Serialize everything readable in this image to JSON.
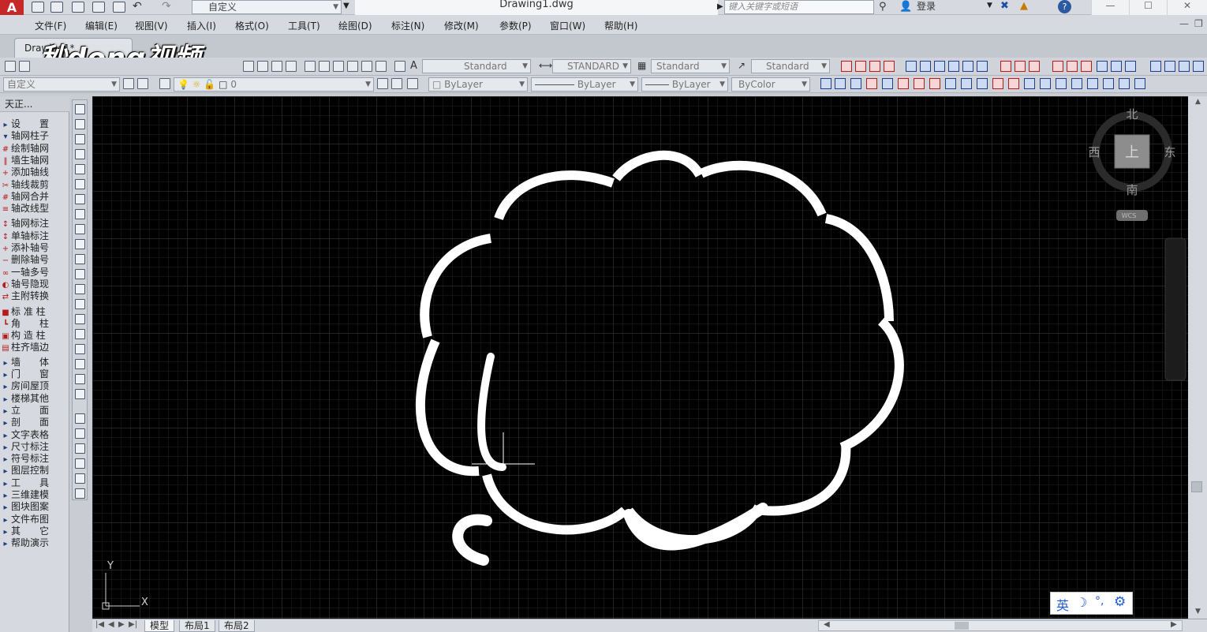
{
  "window": {
    "app_logo": "A",
    "workspace": "自定义",
    "document_title": "Drawing1.dwg",
    "search_placeholder": "键入关键字或短语",
    "login_label": "登录",
    "help_label": "?"
  },
  "menu": [
    "文件(F)",
    "编辑(E)",
    "视图(V)",
    "插入(I)",
    "格式(O)",
    "工具(T)",
    "绘图(D)",
    "标注(N)",
    "修改(M)",
    "参数(P)",
    "窗口(W)",
    "帮助(H)"
  ],
  "tab": {
    "document_tab": "Drawing1*",
    "watermark": "秒dong视频"
  },
  "styles_toolbar": {
    "text_style": "Standard",
    "dim_style": "STANDARD",
    "table_style": "Standard",
    "mleader_style": "Standard"
  },
  "properties_toolbar": {
    "workspace": "自定义",
    "layer": "0",
    "color": "ByLayer",
    "linetype": "ByLayer",
    "lineweight": "ByLayer",
    "plotstyle": "ByColor"
  },
  "left_panel": {
    "title": "天正...",
    "items": [
      {
        "label": "设　　置",
        "kind": "section",
        "glyph": "▸"
      },
      {
        "label": "轴网柱子",
        "kind": "section",
        "glyph": "▾"
      },
      {
        "label": "绘制轴网",
        "kind": "sub",
        "glyph": "#"
      },
      {
        "label": "墙生轴网",
        "kind": "sub",
        "glyph": "‖"
      },
      {
        "label": "添加轴线",
        "kind": "sub",
        "glyph": "+"
      },
      {
        "label": "轴线裁剪",
        "kind": "sub",
        "glyph": "✂"
      },
      {
        "label": "轴网合并",
        "kind": "sub",
        "glyph": "#"
      },
      {
        "label": "轴改线型",
        "kind": "sub",
        "glyph": "≡"
      },
      {
        "label": "轴网标注",
        "kind": "sub",
        "glyph": "↕"
      },
      {
        "label": "单轴标注",
        "kind": "sub",
        "glyph": "↕"
      },
      {
        "label": "添补轴号",
        "kind": "sub",
        "glyph": "+"
      },
      {
        "label": "删除轴号",
        "kind": "sub",
        "glyph": "−"
      },
      {
        "label": "一轴多号",
        "kind": "sub",
        "glyph": "∞"
      },
      {
        "label": "轴号隐现",
        "kind": "sub",
        "glyph": "◐"
      },
      {
        "label": "主附转换",
        "kind": "sub",
        "glyph": "⇄"
      },
      {
        "label": "标 准 柱",
        "kind": "sub",
        "glyph": "■"
      },
      {
        "label": "角　　柱",
        "kind": "sub",
        "glyph": "┗"
      },
      {
        "label": "构 造 柱",
        "kind": "sub",
        "glyph": "▣"
      },
      {
        "label": "柱齐墙边",
        "kind": "sub",
        "glyph": "▤"
      },
      {
        "label": "墙　　体",
        "kind": "section",
        "glyph": "▸"
      },
      {
        "label": "门　　窗",
        "kind": "section",
        "glyph": "▸"
      },
      {
        "label": "房间屋顶",
        "kind": "section",
        "glyph": "▸"
      },
      {
        "label": "楼梯其他",
        "kind": "section",
        "glyph": "▸"
      },
      {
        "label": "立　　面",
        "kind": "section",
        "glyph": "▸"
      },
      {
        "label": "剖　　面",
        "kind": "section",
        "glyph": "▸"
      },
      {
        "label": "文字表格",
        "kind": "section",
        "glyph": "▸"
      },
      {
        "label": "尺寸标注",
        "kind": "section",
        "glyph": "▸"
      },
      {
        "label": "符号标注",
        "kind": "section",
        "glyph": "▸"
      },
      {
        "label": "图层控制",
        "kind": "section",
        "glyph": "▸"
      },
      {
        "label": "工　　具",
        "kind": "section",
        "glyph": "▸"
      },
      {
        "label": "三维建模",
        "kind": "section",
        "glyph": "▸"
      },
      {
        "label": "图块图案",
        "kind": "section",
        "glyph": "▸"
      },
      {
        "label": "文件布图",
        "kind": "section",
        "glyph": "▸"
      },
      {
        "label": "其　　它",
        "kind": "section",
        "glyph": "▸"
      },
      {
        "label": "帮助演示",
        "kind": "section",
        "glyph": "▸"
      }
    ]
  },
  "viewcube": {
    "north": "北",
    "south": "南",
    "east": "东",
    "west": "西",
    "top": "上",
    "wcs": "WCS"
  },
  "ucs": {
    "x": "X",
    "y": "Y"
  },
  "layout_tabs": [
    "模型",
    "布局1",
    "布局2"
  ],
  "ime": {
    "language": "英"
  },
  "colors": {
    "canvas": "#000000",
    "cloud": "#ffffff",
    "toolbar": "#d0d4da",
    "accent_red": "#c62828"
  }
}
